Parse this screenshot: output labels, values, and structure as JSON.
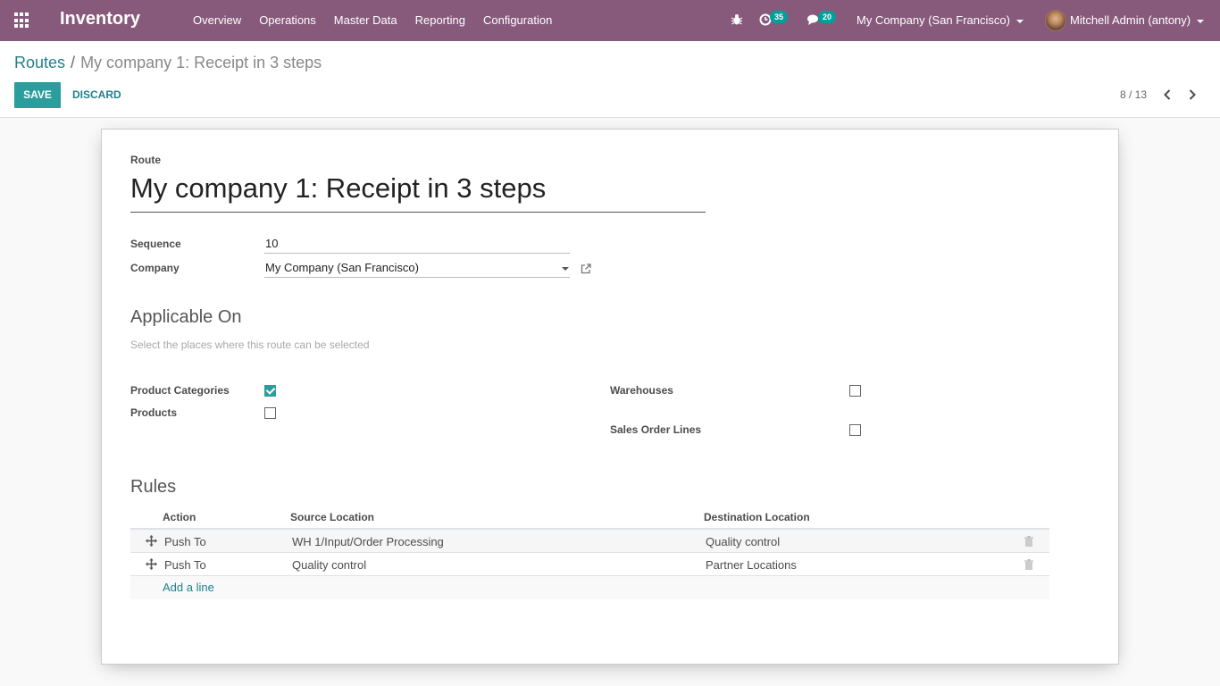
{
  "navbar": {
    "app_title": "Inventory",
    "menu": [
      "Overview",
      "Operations",
      "Master Data",
      "Reporting",
      "Configuration"
    ],
    "activity_count": "35",
    "message_count": "20",
    "company": "My Company (San Francisco)",
    "user": "Mitchell Admin (antony)",
    "accent_color": "#875a7b"
  },
  "control_panel": {
    "breadcrumb_parent": "Routes",
    "breadcrumb_separator": "/",
    "breadcrumb_current": "My company 1: Receipt in 3 steps",
    "save_label": "SAVE",
    "discard_label": "DISCARD",
    "pager": "8 / 13"
  },
  "form": {
    "route_label": "Route",
    "route_name": "My company 1: Receipt in 3 steps",
    "sequence_label": "Sequence",
    "sequence_value": "10",
    "company_label": "Company",
    "company_value": "My Company (San Francisco)",
    "applicable_title": "Applicable On",
    "applicable_help": "Select the places where this route can be selected",
    "product_categories_label": "Product Categories",
    "product_categories_checked": true,
    "products_label": "Products",
    "products_checked": false,
    "warehouses_label": "Warehouses",
    "warehouses_checked": false,
    "sale_lines_label": "Sales Order Lines",
    "sale_lines_checked": false,
    "rules_title": "Rules",
    "rules_headers": {
      "action": "Action",
      "source": "Source Location",
      "destination": "Destination Location"
    },
    "rules": [
      {
        "action": "Push To",
        "source": "WH 1/Input/Order Processing",
        "destination": "Quality control"
      },
      {
        "action": "Push To",
        "source": "Quality control",
        "destination": "Partner Locations"
      }
    ],
    "add_line": "Add a line",
    "checkbox_color": "#2a9d9c"
  }
}
